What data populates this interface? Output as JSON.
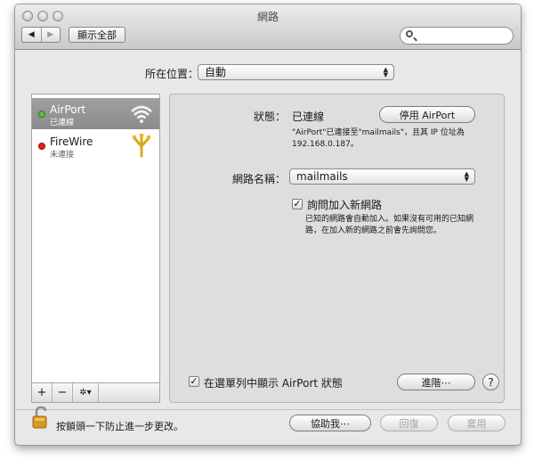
{
  "window": {
    "title": "網路"
  },
  "toolbar": {
    "back_glyph": "◀",
    "forward_glyph": "▶",
    "show_all_label": "顯示全部",
    "search": {
      "value": "",
      "placeholder": ""
    }
  },
  "location": {
    "label": "所在位置：",
    "value": "自動"
  },
  "sidebar": {
    "items": [
      {
        "name": "AirPort",
        "status": "已連線",
        "status_color": "#4caf2a",
        "icon": "wifi-icon"
      },
      {
        "name": "FireWire",
        "status": "未連接",
        "status_color": "#d21414",
        "icon": "firewire-icon"
      }
    ],
    "add_glyph": "+",
    "remove_glyph": "−",
    "gear_glyph": "✲▾"
  },
  "detail": {
    "status_label": "狀態：",
    "status_value": "已連線",
    "disable_button": "停用 AirPort",
    "status_note_1": "\"AirPort\"已連接至\"mailmails\"，且其 IP 位址為",
    "status_note_2": "192.168.0.187。",
    "network_name_label": "網路名稱：",
    "network_name_value": "mailmails",
    "ask_join_label": "詢問加入新網路",
    "ask_join_checked": "✓",
    "ask_join_note_1": "已知的網路會自動加入。如果沒有可用的已知網",
    "ask_join_note_2": "路，在加入新的網路之前會先詢問您。",
    "menubar_label": "在選單列中顯示 AirPort 狀態",
    "menubar_checked": "✓",
    "advanced_button": "進階⋯",
    "help_glyph": "?"
  },
  "footer": {
    "lock_text": "按鎖頭一下防止進一步更改。",
    "assist_button": "協助我⋯",
    "revert_button": "回復",
    "apply_button": "套用"
  },
  "colors": {
    "selection": "#939393",
    "panel": "#dedede"
  }
}
